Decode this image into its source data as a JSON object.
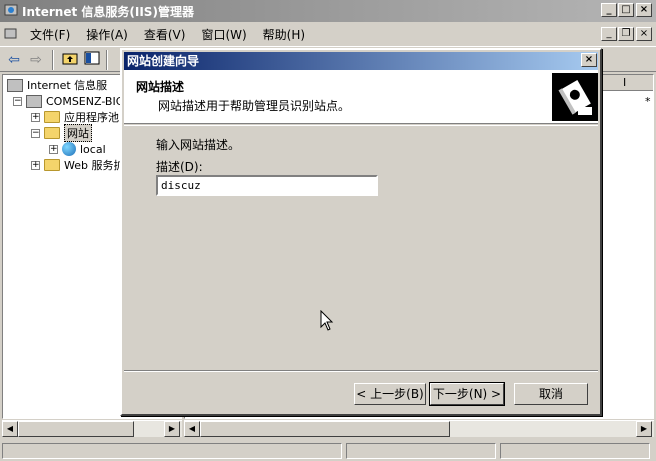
{
  "window": {
    "title": "Internet 信息服务(IIS)管理器",
    "min_glyph": "_",
    "max_glyph": "□",
    "close_glyph": "×"
  },
  "menu": {
    "items": [
      "文件(F)",
      "操作(A)",
      "查看(V)",
      "窗口(W)",
      "帮助(H)"
    ]
  },
  "tree": {
    "root": "Internet 信息服",
    "computer": "COMSENZ-BIGH",
    "app_pools": "应用程序池",
    "websites": "网站",
    "local": "local",
    "web_ext": "Web 服务扩",
    "expand_plus": "+",
    "expand_minus": "−"
  },
  "right_header_char": "I",
  "right_star": "*",
  "wizard": {
    "title": "网站创建向导",
    "heading": "网站描述",
    "subheading": "网站描述用于帮助管理员识别站点。",
    "prompt": "输入网站描述。",
    "desc_label": "描述(D):",
    "desc_value": "discuz",
    "back_label": "< 上一步(B)",
    "next_label": "下一步(N) >",
    "cancel_label": "取消",
    "close_glyph": "×"
  },
  "colors": {
    "titlebar_inactive": "#808080",
    "dialog_title": "#0a246a",
    "face": "#d4d0c8"
  }
}
